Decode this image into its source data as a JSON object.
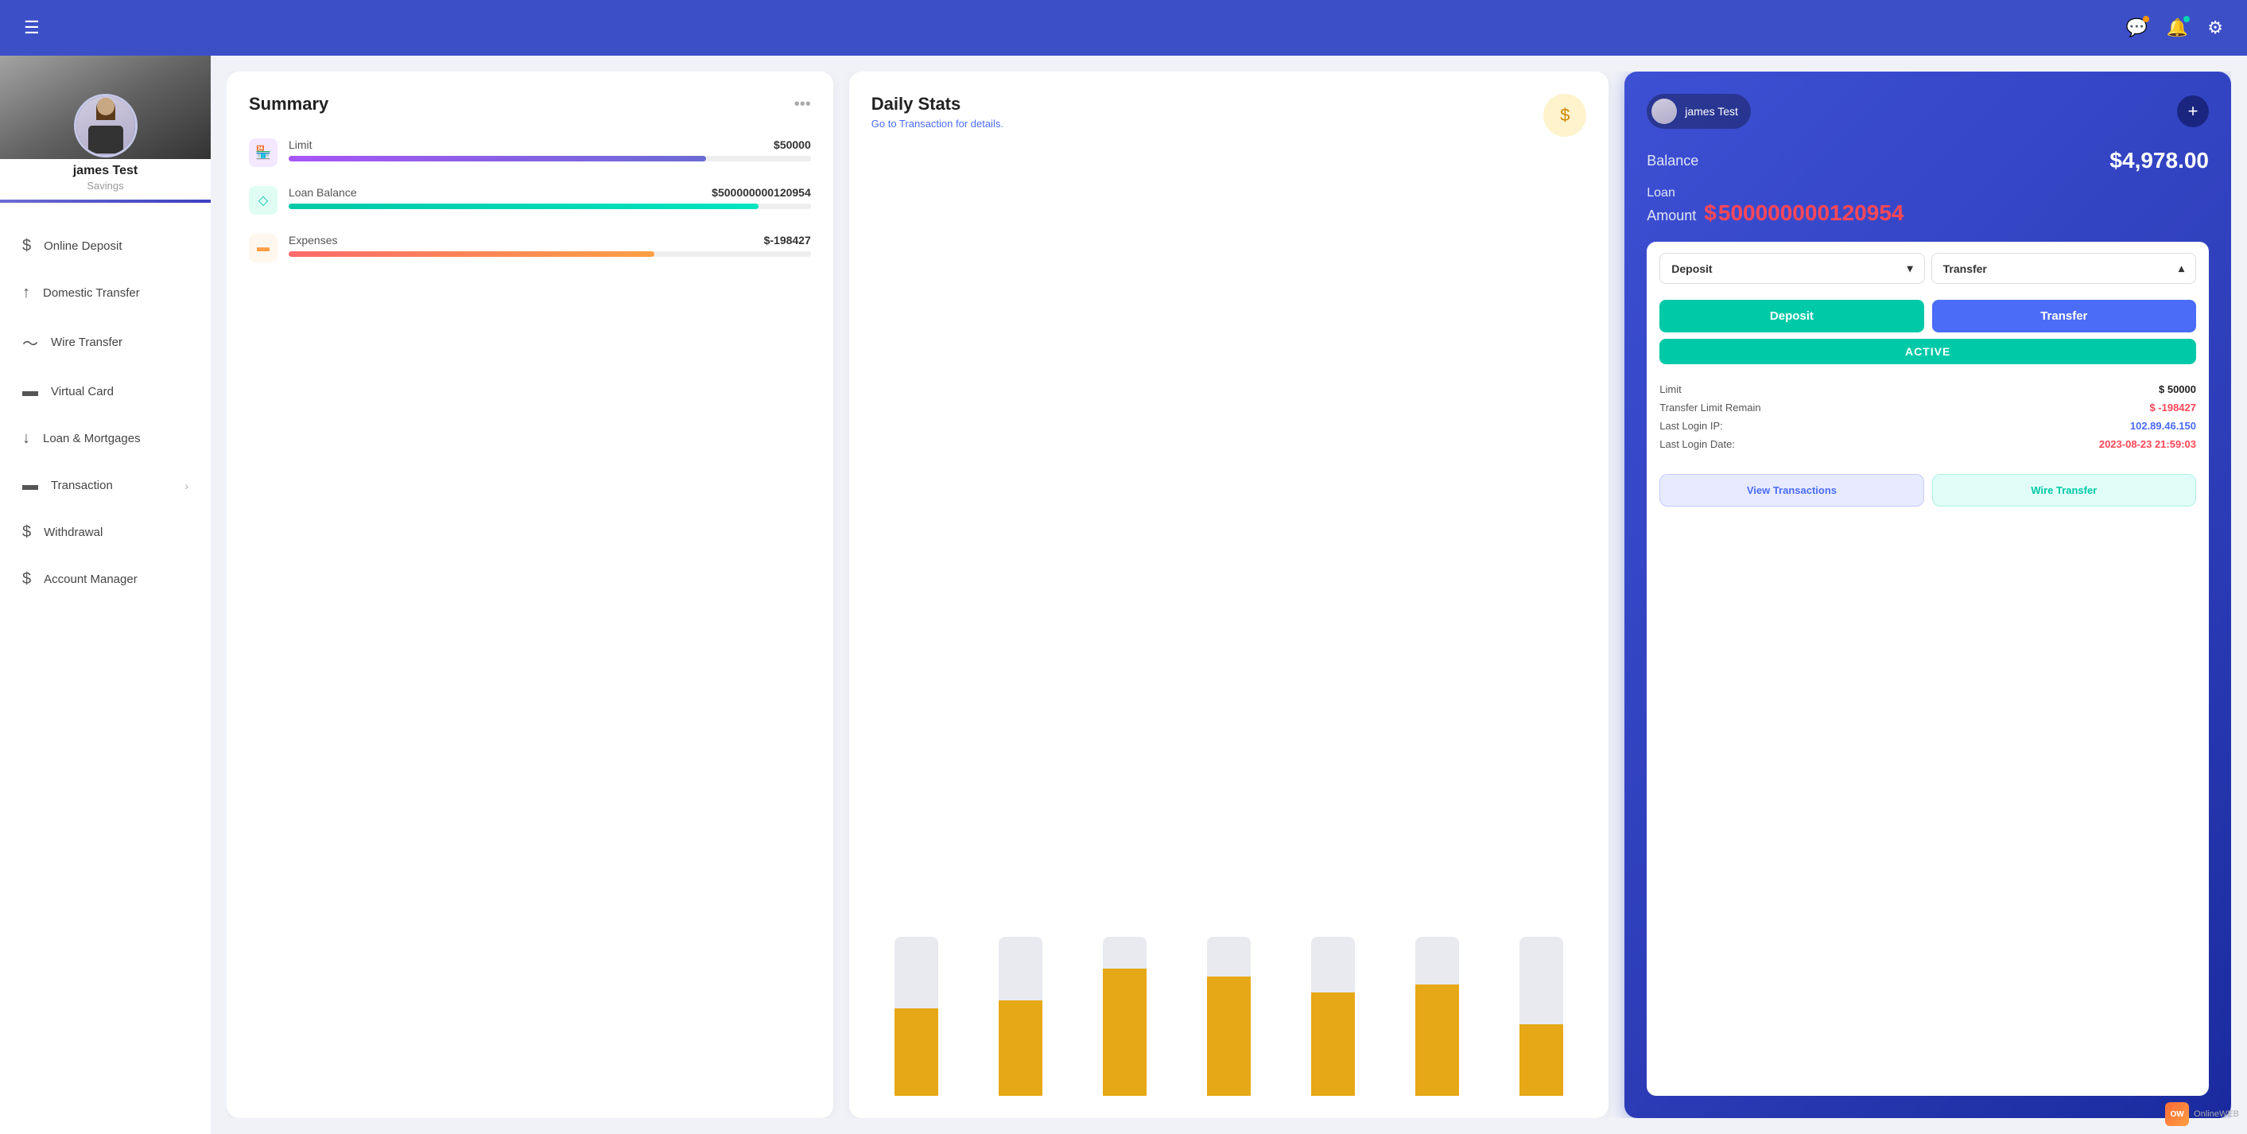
{
  "topNav": {
    "hamburger": "☰",
    "icons": {
      "chat": "💬",
      "bell": "🔔",
      "settings": "⚙"
    },
    "badges": {
      "chat": "orange",
      "bell": "teal"
    }
  },
  "sidebar": {
    "userName": "james Test",
    "accountType": "Savings",
    "navItems": [
      {
        "id": "online-deposit",
        "label": "Online Deposit",
        "icon": "$",
        "hasArrow": false
      },
      {
        "id": "domestic-transfer",
        "label": "Domestic Transfer",
        "icon": "↑",
        "hasArrow": false
      },
      {
        "id": "wire-transfer",
        "label": "Wire Transfer",
        "icon": "~",
        "hasArrow": false
      },
      {
        "id": "virtual-card",
        "label": "Virtual Card",
        "icon": "▬",
        "hasArrow": false
      },
      {
        "id": "loan-mortgages",
        "label": "Loan & Mortgages",
        "icon": "↓",
        "hasArrow": false
      },
      {
        "id": "transaction",
        "label": "Transaction",
        "icon": "▬",
        "hasArrow": true
      },
      {
        "id": "withdrawal",
        "label": "Withdrawal",
        "icon": "$",
        "hasArrow": false
      },
      {
        "id": "account-manager",
        "label": "Account Manager",
        "icon": "$",
        "hasArrow": false
      }
    ]
  },
  "summary": {
    "title": "Summary",
    "menuIcon": "•••",
    "items": [
      {
        "id": "limit",
        "label": "Limit",
        "value": "$50000",
        "barClass": "bar-purple",
        "iconClass": "icon-purple",
        "iconSymbol": "🏪"
      },
      {
        "id": "loan-balance",
        "label": "Loan Balance",
        "value": "$500000000120954",
        "barClass": "bar-teal",
        "iconClass": "icon-teal",
        "iconSymbol": "◇"
      },
      {
        "id": "expenses",
        "label": "Expenses",
        "value": "$-198427",
        "barClass": "bar-red",
        "iconClass": "icon-orange",
        "iconSymbol": "▬"
      }
    ]
  },
  "dailyStats": {
    "title": "Daily Stats",
    "subtitle": "Go to Transaction for details.",
    "iconSymbol": "$",
    "bars": [
      {
        "height": 55
      },
      {
        "height": 60
      },
      {
        "height": 80
      },
      {
        "height": 75
      },
      {
        "height": 65
      },
      {
        "height": 70
      },
      {
        "height": 45
      }
    ]
  },
  "accountCard": {
    "userName": "james Test",
    "addBtn": "+",
    "balanceLabel": "Balance",
    "balanceValue": "$4,978.00",
    "loanLabel": "Loan",
    "loanAmountLabel": "Amount",
    "loanDollar": "$",
    "loanValue": "500000000120954",
    "actionPanel": {
      "depositTab": "Deposit",
      "transferTab": "Transfer",
      "depositChevron": "▾",
      "transferChevron": "▴",
      "depositBtn": "Deposit",
      "transferBtn": "Transfer"
    },
    "activeBadge": "ACTIVE",
    "details": {
      "limitLabel": "Limit",
      "limitValue": "$ 50000",
      "transferLimitLabel": "Transfer Limit Remain",
      "transferLimitValue": "$ -198427",
      "lastLoginIPLabel": "Last Login IP:",
      "lastLoginIPValue": "102.89.46.150",
      "lastLoginDateLabel": "Last Login Date:",
      "lastLoginDateValue": "2023-08-23 21:59:03"
    },
    "viewTransactions": "View Transactions",
    "wireTransfer": "Wire Transfer"
  }
}
